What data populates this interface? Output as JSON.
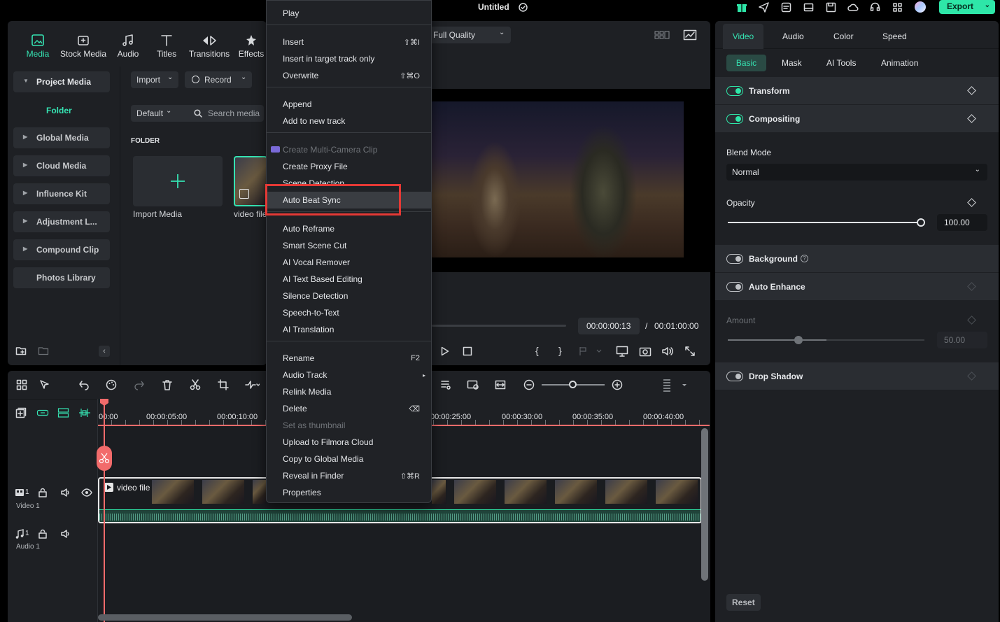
{
  "topbar": {
    "title": "Untitled",
    "export_label": "Export"
  },
  "media_tabs": [
    {
      "label": "Media",
      "icon": "media-icon"
    },
    {
      "label": "Stock Media",
      "icon": "stock-media-icon"
    },
    {
      "label": "Audio",
      "icon": "music-note-icon"
    },
    {
      "label": "Titles",
      "icon": "titles-icon"
    },
    {
      "label": "Transitions",
      "icon": "transitions-icon"
    },
    {
      "label": "Effects",
      "icon": "effects-icon"
    }
  ],
  "sidebar": {
    "project_media": "Project Media",
    "folder": "Folder",
    "items": [
      "Global Media",
      "Cloud Media",
      "Influence Kit",
      "Adjustment L...",
      "Compound Clip",
      "Photos Library"
    ]
  },
  "media": {
    "import_label": "Import",
    "record_label": "Record",
    "sort_label": "Default",
    "search_placeholder": "Search media",
    "folder_heading": "FOLDER",
    "import_media_label": "Import Media",
    "video_file_label": "video file"
  },
  "preview": {
    "quality": "Full Quality",
    "current_time": "00:00:00:13",
    "separator": "/",
    "total_time": "00:01:00:00"
  },
  "context_menu": {
    "groups": [
      [
        {
          "label": "Play",
          "shortcut": ""
        }
      ],
      [
        {
          "label": "Insert",
          "shortcut": "⇧⌘I"
        },
        {
          "label": "Insert in target track only",
          "shortcut": ""
        },
        {
          "label": "Overwrite",
          "shortcut": "⇧⌘O"
        }
      ],
      [
        {
          "label": "Append",
          "shortcut": ""
        },
        {
          "label": "Add to new track",
          "shortcut": ""
        }
      ],
      [
        {
          "label": "Create Multi-Camera Clip",
          "shortcut": "",
          "disabled": true
        },
        {
          "label": "Create Proxy File",
          "shortcut": ""
        },
        {
          "label": "Scene Detection",
          "shortcut": ""
        },
        {
          "label": "Auto Beat Sync",
          "shortcut": "",
          "highlighted": true
        }
      ],
      [
        {
          "label": "Auto Reframe",
          "shortcut": ""
        },
        {
          "label": "Smart Scene Cut",
          "shortcut": ""
        },
        {
          "label": "AI Vocal Remover",
          "shortcut": ""
        },
        {
          "label": "AI Text Based Editing",
          "shortcut": ""
        },
        {
          "label": "Silence Detection",
          "shortcut": ""
        },
        {
          "label": "Speech-to-Text",
          "shortcut": ""
        },
        {
          "label": "AI Translation",
          "shortcut": ""
        }
      ],
      [
        {
          "label": "Rename",
          "shortcut": "F2"
        },
        {
          "label": "Audio Track",
          "shortcut": "▸"
        },
        {
          "label": "Relink Media",
          "shortcut": ""
        },
        {
          "label": "Delete",
          "shortcut": "⌫"
        },
        {
          "label": "Set as thumbnail",
          "shortcut": "",
          "disabled": true
        },
        {
          "label": "Upload to Filmora Cloud",
          "shortcut": ""
        },
        {
          "label": "Copy to Global Media",
          "shortcut": ""
        },
        {
          "label": "Reveal in Finder",
          "shortcut": "⇧⌘R"
        },
        {
          "label": "Properties",
          "shortcut": ""
        }
      ]
    ],
    "highlight_color": "#e53935"
  },
  "inspector": {
    "tabs": [
      "Video",
      "Audio",
      "Color",
      "Speed"
    ],
    "subtabs": [
      "Basic",
      "Mask",
      "AI Tools",
      "Animation"
    ],
    "transform": "Transform",
    "compositing": "Compositing",
    "blend_mode_label": "Blend Mode",
    "blend_mode_value": "Normal",
    "opacity_label": "Opacity",
    "opacity_value": "100.00",
    "opacity_fraction": 1.0,
    "background": "Background",
    "auto_enhance": "Auto Enhance",
    "amount_label": "Amount",
    "amount_value": "50.00",
    "amount_fraction": 0.5,
    "drop_shadow": "Drop Shadow",
    "reset_label": "Reset"
  },
  "timeline": {
    "ruler": [
      "00:00",
      "00:00:05:00",
      "00:00:10:00",
      "00:00:25:00",
      "00:00:30:00",
      "00:00:35:00",
      "00:00:40:00"
    ],
    "video_track_label": "Video 1",
    "audio_track_label": "Audio 1",
    "track_num": "1",
    "clip_label": "video file"
  },
  "colors": {
    "accent": "#2ee6a8",
    "playhead": "#f26b6b"
  }
}
